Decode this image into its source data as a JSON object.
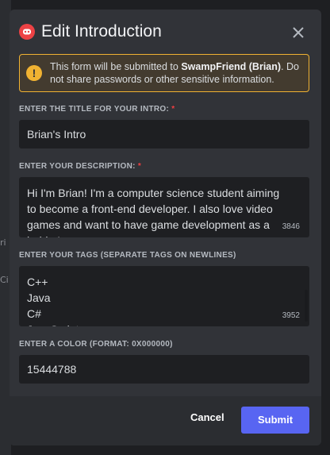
{
  "backdrop": {
    "fragment_1": "ri",
    "fragment_2": "Ci"
  },
  "modal": {
    "title": "Edit Introduction",
    "close_icon": "close-icon"
  },
  "warning": {
    "icon": "warning-icon",
    "prefix": "This form will be submitted to ",
    "app_name": "SwampFriend (Brian)",
    "suffix": ". Do not share passwords or other sensitive information."
  },
  "fields": {
    "title": {
      "label": "ENTER THE TITLE FOR YOUR INTRO:",
      "required_mark": "*",
      "value": "Brian's Intro"
    },
    "description": {
      "label": "ENTER YOUR DESCRIPTION:",
      "required_mark": "*",
      "value": "Hi I'm Brian! I'm a computer science student aiming to become a front-end developer. I also love video games and want to have game development as a hobby!",
      "remaining": "3846"
    },
    "tags": {
      "label": "ENTER YOUR TAGS (SEPARATE TAGS ON NEWLINES)",
      "value": "C++\nJava\nC#\nJavaScript",
      "remaining": "3952"
    },
    "color": {
      "label": "ENTER A COLOR (FORMAT: 0X000000)",
      "value": "15444788"
    }
  },
  "footer": {
    "cancel_label": "Cancel",
    "submit_label": "Submit"
  },
  "colors": {
    "accent": "#5865f2",
    "warning": "#f0b232",
    "required": "#f23f42",
    "logo": "#ed4245"
  }
}
